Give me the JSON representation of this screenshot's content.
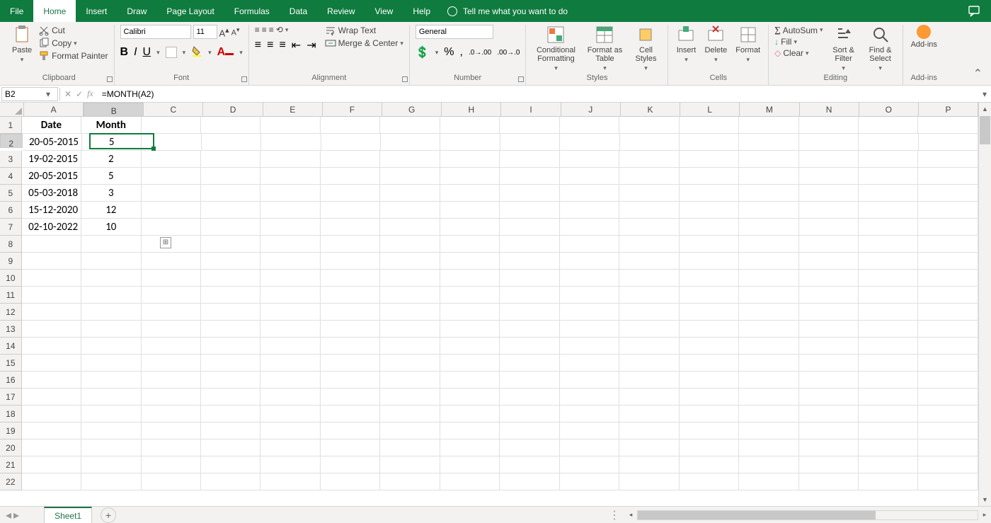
{
  "tabs": {
    "file": "File",
    "home": "Home",
    "insert": "Insert",
    "draw": "Draw",
    "pagelayout": "Page Layout",
    "formulas": "Formulas",
    "data": "Data",
    "review": "Review",
    "view": "View",
    "help": "Help"
  },
  "tellme": "Tell me what you want to do",
  "clipboard": {
    "title": "Clipboard",
    "paste": "Paste",
    "cut": "Cut",
    "copy": "Copy",
    "painter": "Format Painter"
  },
  "font": {
    "title": "Font",
    "name": "Calibri",
    "size": "11"
  },
  "alignment": {
    "title": "Alignment",
    "wrap": "Wrap Text",
    "merge": "Merge & Center"
  },
  "number": {
    "title": "Number",
    "format": "General"
  },
  "styles": {
    "title": "Styles",
    "cond": "Conditional Formatting",
    "table": "Format as Table",
    "cell": "Cell Styles"
  },
  "cells": {
    "title": "Cells",
    "insert": "Insert",
    "delete": "Delete",
    "format": "Format"
  },
  "editing": {
    "title": "Editing",
    "autosum": "AutoSum",
    "fill": "Fill",
    "clear": "Clear",
    "sort": "Sort & Filter",
    "find": "Find & Select"
  },
  "addins": {
    "title": "Add-ins",
    "label": "Add-ins"
  },
  "namebox": "B2",
  "formula": "=MONTH(A2)",
  "cols": [
    "A",
    "B",
    "C",
    "D",
    "E",
    "F",
    "G",
    "H",
    "I",
    "J",
    "K",
    "L",
    "M",
    "N",
    "O",
    "P"
  ],
  "rowcount": 22,
  "headers": {
    "A": "Date",
    "B": "Month"
  },
  "data": [
    {
      "A": "20-05-2015",
      "B": "5"
    },
    {
      "A": "19-02-2015",
      "B": "2"
    },
    {
      "A": "20-05-2015",
      "B": "5"
    },
    {
      "A": "05-03-2018",
      "B": "3"
    },
    {
      "A": "15-12-2020",
      "B": "12"
    },
    {
      "A": "02-10-2022",
      "B": "10"
    }
  ],
  "sheettab": "Sheet1",
  "selected_cell": "B2"
}
